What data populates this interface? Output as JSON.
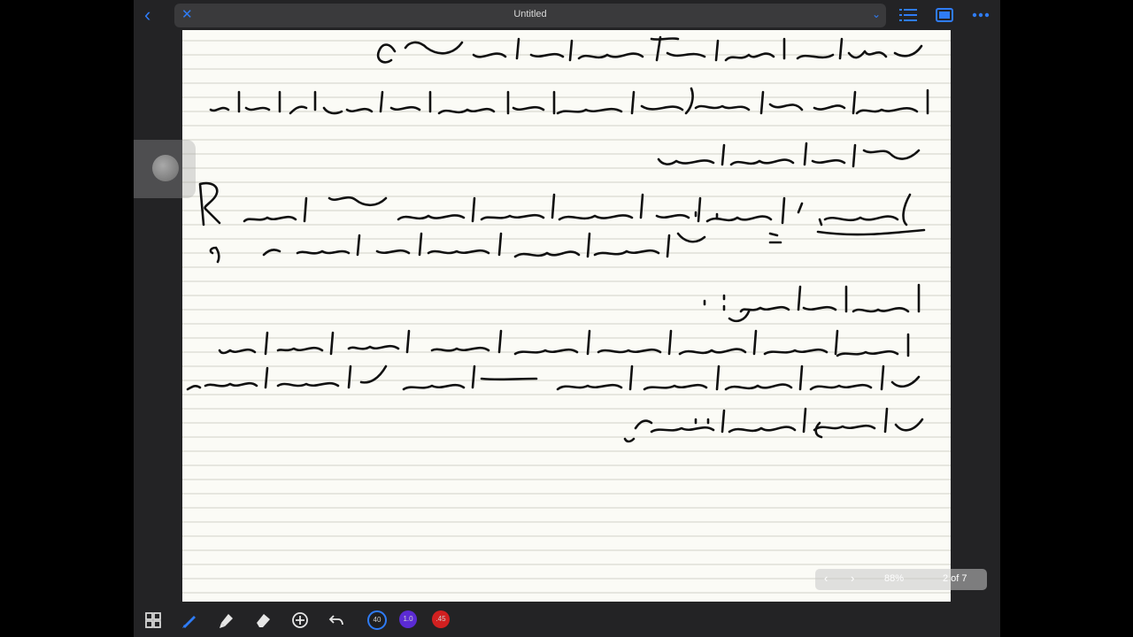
{
  "header": {
    "title": "Untitled",
    "back_icon": "chevron-left-icon",
    "close_icon": "close-icon",
    "dropdown_icon": "chevron-down-icon",
    "right_icons": [
      "list-icon",
      "page-view-icon",
      "more-icon"
    ],
    "accent": "#2f7cf6"
  },
  "pager": {
    "zoom": "88%",
    "page_status": "2 of 7",
    "prev_icon": "chevron-left-icon",
    "next_icon": "chevron-right-icon"
  },
  "toolbar": {
    "tools": [
      "grid-icon",
      "pen-icon",
      "highlighter-icon",
      "eraser-icon",
      "add-icon",
      "undo-icon"
    ],
    "swatches": [
      {
        "label": "40",
        "color": "#1f1f1f"
      },
      {
        "label": "1.0",
        "color": "#5b2bd4"
      },
      {
        "label": ".45",
        "color": "#d12020"
      }
    ]
  },
  "note": {
    "content": "handwritten Arabic notes",
    "text_lines": [
      "واجبا طفلان كان الأسرة السر اليد",
      "العوامل الوراثية والمظهرية للأباء والأبناء",
      "وما نوع الوراثة",
      "الحل : ١- نرمز لعامل صفة اليد اليمنى بالحرف R",
      "٢- نرمز لعامل صفة اليد اليسرى r",
      "الاستنتاج :",
      "١) ورود أحد الأبناء أعسر اليد هذا يدل",
      "على أن صفة اليد اليمنى سائدة وهي",
      "وطرازها الوراثي"
    ]
  }
}
